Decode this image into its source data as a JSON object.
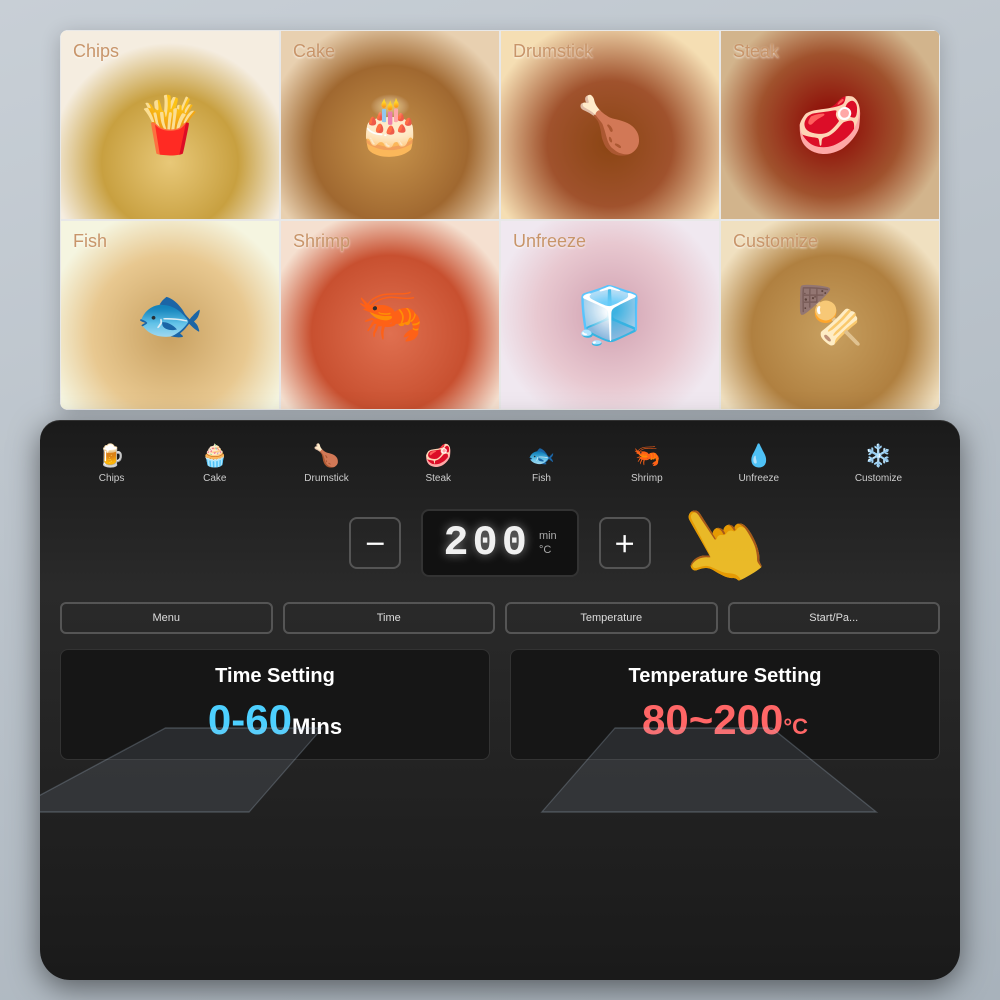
{
  "background": {
    "color": "#b2bec9"
  },
  "food_items": [
    {
      "id": "chips",
      "label": "Chips",
      "emoji": "🍟",
      "bg": "chips"
    },
    {
      "id": "cake",
      "label": "Cake",
      "emoji": "🎂",
      "bg": "cake"
    },
    {
      "id": "drumstick",
      "label": "Drumstick",
      "emoji": "🍗",
      "bg": "drumstick"
    },
    {
      "id": "steak",
      "label": "Steak",
      "emoji": "🥩",
      "bg": "steak"
    },
    {
      "id": "fish",
      "label": "Fish",
      "emoji": "🐟",
      "bg": "fish"
    },
    {
      "id": "shrimp",
      "label": "Shrimp",
      "emoji": "🦐",
      "bg": "shrimp"
    },
    {
      "id": "unfreeze",
      "label": "Unfreeze",
      "emoji": "🧊",
      "bg": "unfreeze"
    },
    {
      "id": "customize",
      "label": "Customize",
      "emoji": "🍢",
      "bg": "customize"
    }
  ],
  "mode_icons": [
    {
      "id": "chips",
      "symbol": "🍺",
      "label": "Chips"
    },
    {
      "id": "cake",
      "symbol": "🧁",
      "label": "Cake"
    },
    {
      "id": "drumstick",
      "symbol": "🍗",
      "label": "Drumstick"
    },
    {
      "id": "steak",
      "symbol": "🥩",
      "label": "Steak"
    },
    {
      "id": "fish",
      "symbol": "🐟",
      "label": "Fish"
    },
    {
      "id": "shrimp",
      "symbol": "🦐",
      "label": "Shrimp"
    },
    {
      "id": "unfreeze",
      "symbol": "💧",
      "label": "Unfreeze"
    },
    {
      "id": "customize",
      "symbol": "❄️",
      "label": "Customize"
    }
  ],
  "display": {
    "value": "200",
    "unit_top": "min",
    "unit_bottom": "°C"
  },
  "buttons": [
    {
      "id": "minus",
      "label": "－"
    },
    {
      "id": "plus",
      "label": "＋"
    }
  ],
  "func_buttons": [
    {
      "id": "menu",
      "label": "Menu"
    },
    {
      "id": "time",
      "label": "Time"
    },
    {
      "id": "temperature",
      "label": "Temperature"
    },
    {
      "id": "start",
      "label": "Start/Pa..."
    }
  ],
  "info_panels": {
    "time": {
      "title": "Time Setting",
      "range_start": "0",
      "separator": "-",
      "range_end": "60",
      "unit": "Mins"
    },
    "temperature": {
      "title": "Temperature Setting",
      "range_start": "80",
      "separator": "~",
      "range_end": "200",
      "unit": "°C"
    }
  }
}
